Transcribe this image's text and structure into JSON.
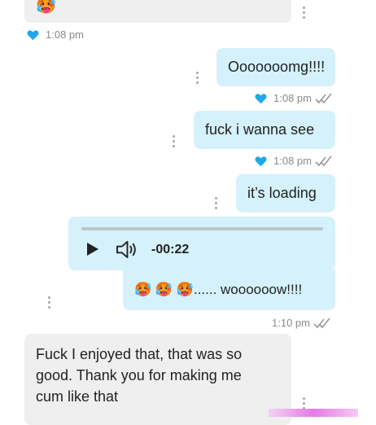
{
  "messages": [
    {
      "id": "m0",
      "side": "in",
      "text": "🥵"
    },
    {
      "id": "m1",
      "side": "out",
      "text": "Ooooooomg!!!!",
      "time": "1:08 pm"
    },
    {
      "id": "m2",
      "side": "out",
      "text": "fuck i wanna see",
      "time": "1:08 pm"
    },
    {
      "id": "m3",
      "side": "out",
      "text": "it’s loading"
    },
    {
      "id": "m5",
      "side": "out",
      "text": "🥵 🥵 🥵...... woooooow!!!!",
      "time": "1:10 pm"
    },
    {
      "id": "m6",
      "side": "in",
      "text": "Fuck I enjoyed that, that was so good. Thank you for making me cum like that"
    }
  ],
  "first_time": "1:08 pm",
  "voice_note": {
    "duration": "-00:22",
    "progress": 0.0
  },
  "colors": {
    "incoming": "#efefef",
    "outgoing": "#d5f1fb",
    "heart": "#1fa9e8",
    "meta": "#8a8a8a"
  },
  "icons": {
    "reaction": "heart-icon",
    "read": "double-check-icon",
    "play": "play-icon",
    "volume": "speaker-icon",
    "menu": "more-vert-icon"
  }
}
